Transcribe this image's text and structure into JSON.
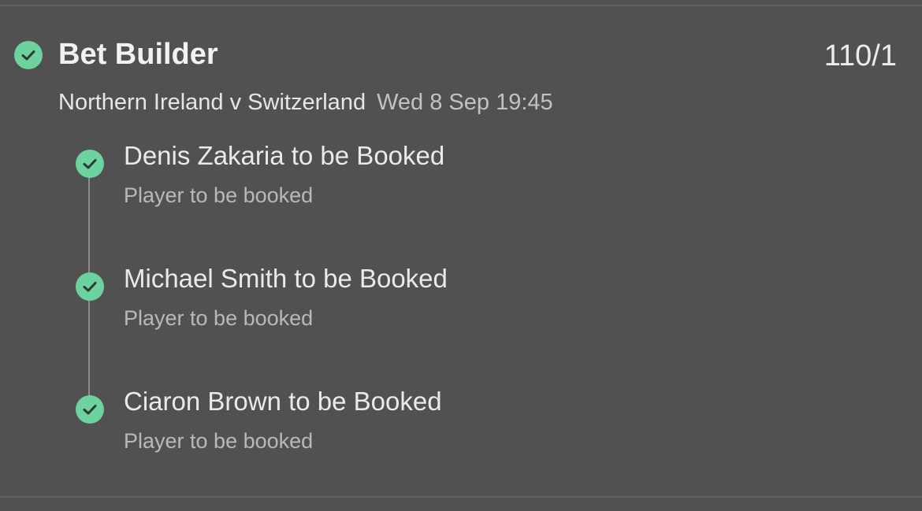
{
  "bet": {
    "type_label": "Bet Builder",
    "odds": "110/1",
    "match": "Northern Ireland v Switzerland",
    "datetime": "Wed 8 Sep 19:45"
  },
  "legs": [
    {
      "title": "Denis Zakaria to be Booked",
      "market": "Player to be booked"
    },
    {
      "title": "Michael Smith to be Booked",
      "market": "Player to be booked"
    },
    {
      "title": "Ciaron Brown to be Booked",
      "market": "Player to be booked"
    }
  ],
  "colors": {
    "background": "#515151",
    "check_green": "#6cd39e",
    "check_mark": "#2d3a33",
    "timeline": "#8b8b8b"
  },
  "icons": {
    "status": "check-circle-icon"
  }
}
